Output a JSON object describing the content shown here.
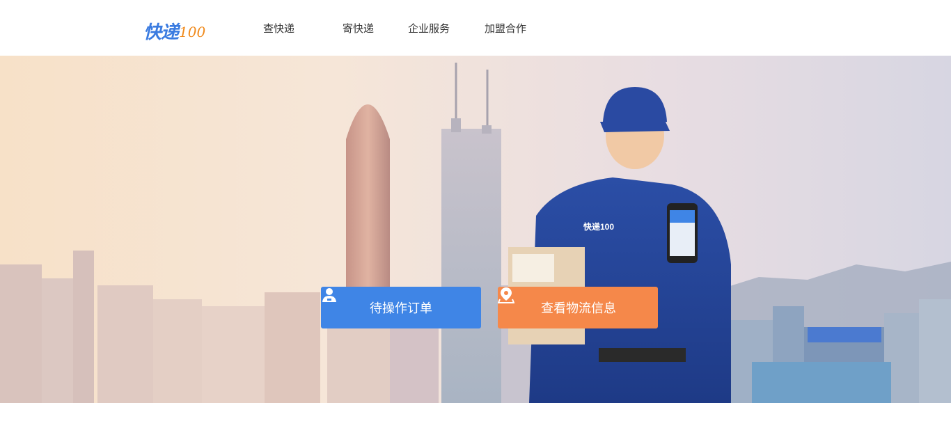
{
  "brand": {
    "logo_cn": "快递",
    "logo_num": "100"
  },
  "nav": [
    {
      "label": "查快递"
    },
    {
      "label": "寄快递"
    },
    {
      "label": "企业服务"
    },
    {
      "label": "加盟合作"
    }
  ],
  "banner": {
    "courier_badge": "快递100",
    "buttons": [
      {
        "label": "待操作订单",
        "icon": "user-icon",
        "color": "#3f85e6"
      },
      {
        "label": "查看物流信息",
        "icon": "map-pin-icon",
        "color": "#f5884a"
      }
    ]
  }
}
